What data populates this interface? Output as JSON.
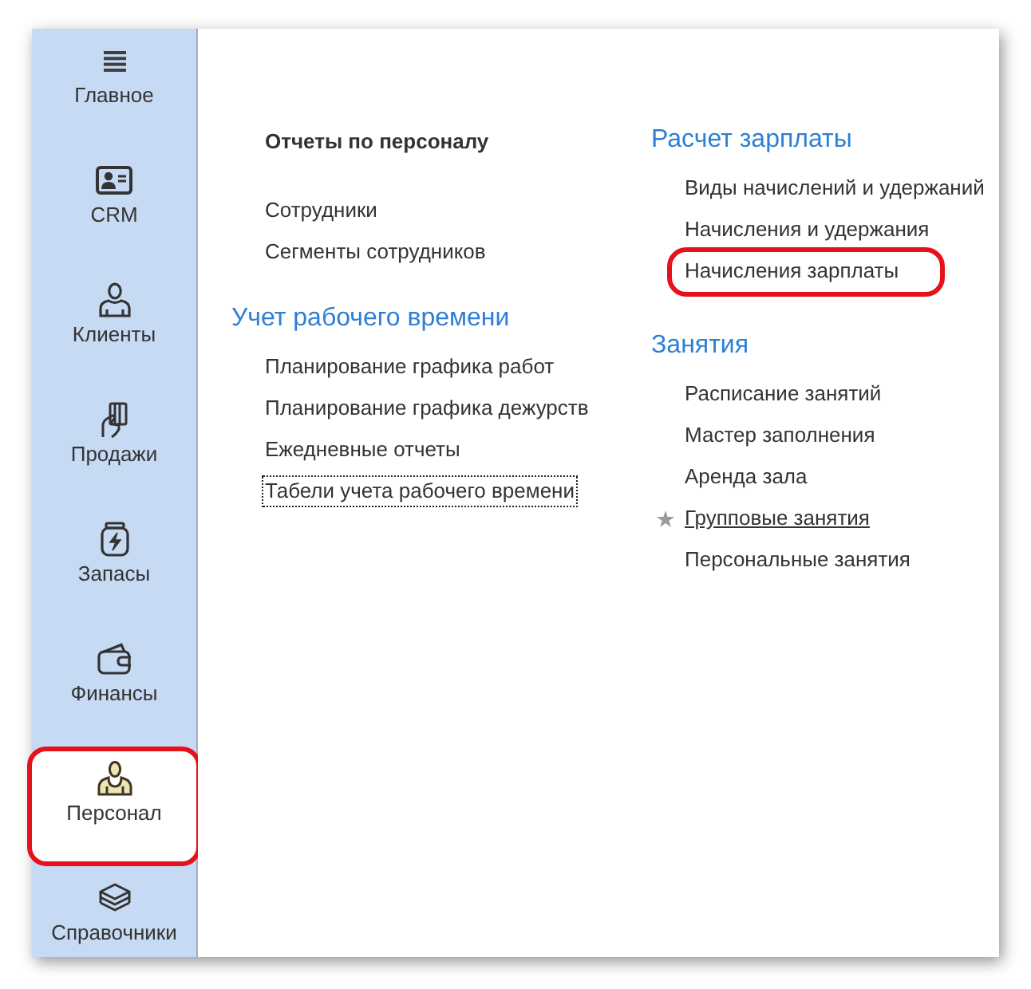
{
  "sidebar": {
    "items": [
      {
        "label": "Главное",
        "selected": false,
        "highlighted": false
      },
      {
        "label": "CRM",
        "selected": false,
        "highlighted": false
      },
      {
        "label": "Клиенты",
        "selected": false,
        "highlighted": false
      },
      {
        "label": "Продажи",
        "selected": false,
        "highlighted": false
      },
      {
        "label": "Запасы",
        "selected": false,
        "highlighted": false
      },
      {
        "label": "Финансы",
        "selected": false,
        "highlighted": false
      },
      {
        "label": "Персонал",
        "selected": true,
        "highlighted": true
      },
      {
        "label": "Справочники",
        "selected": false,
        "highlighted": false
      }
    ]
  },
  "columns": [
    {
      "groups": [
        {
          "items": [
            {
              "label": "Отчеты по персоналу",
              "kind": "important",
              "focused": false,
              "hovered": false,
              "highlighted": false
            }
          ]
        },
        {
          "items": [
            {
              "label": "Сотрудники",
              "kind": "command",
              "focused": false,
              "hovered": false,
              "highlighted": false
            },
            {
              "label": "Сегменты сотрудников",
              "kind": "command",
              "focused": false,
              "hovered": false,
              "highlighted": false
            }
          ]
        },
        {
          "heading": "Учет рабочего времени",
          "items": [
            {
              "label": "Планирование графика работ",
              "kind": "command",
              "focused": false,
              "hovered": false,
              "highlighted": false
            },
            {
              "label": "Планирование графика дежурств",
              "kind": "command",
              "focused": false,
              "hovered": false,
              "highlighted": false
            },
            {
              "label": "Ежедневные отчеты",
              "kind": "command",
              "focused": false,
              "hovered": false,
              "highlighted": false
            },
            {
              "label": "Табели учета рабочего времени",
              "kind": "command",
              "focused": true,
              "hovered": false,
              "highlighted": false
            }
          ]
        }
      ]
    },
    {
      "groups": [
        {
          "heading": "Расчет зарплаты",
          "items": [
            {
              "label": "Виды начислений и удержаний",
              "kind": "command",
              "focused": false,
              "hovered": false,
              "highlighted": false
            },
            {
              "label": "Начисления и удержания",
              "kind": "command",
              "focused": false,
              "hovered": false,
              "highlighted": false
            },
            {
              "label": "Начисления зарплаты",
              "kind": "command",
              "focused": false,
              "hovered": false,
              "highlighted": true
            }
          ]
        },
        {
          "heading": "Занятия",
          "items": [
            {
              "label": "Расписание занятий",
              "kind": "command",
              "focused": false,
              "hovered": false,
              "highlighted": false
            },
            {
              "label": "Мастер заполнения",
              "kind": "command",
              "focused": false,
              "hovered": false,
              "highlighted": false
            },
            {
              "label": "Аренда зала",
              "kind": "command",
              "focused": false,
              "hovered": false,
              "highlighted": false
            },
            {
              "label": "Групповые занятия",
              "kind": "command",
              "focused": false,
              "hovered": true,
              "highlighted": false
            },
            {
              "label": "Персональные занятия",
              "kind": "command",
              "focused": false,
              "hovered": false,
              "highlighted": false
            }
          ]
        }
      ]
    }
  ]
}
